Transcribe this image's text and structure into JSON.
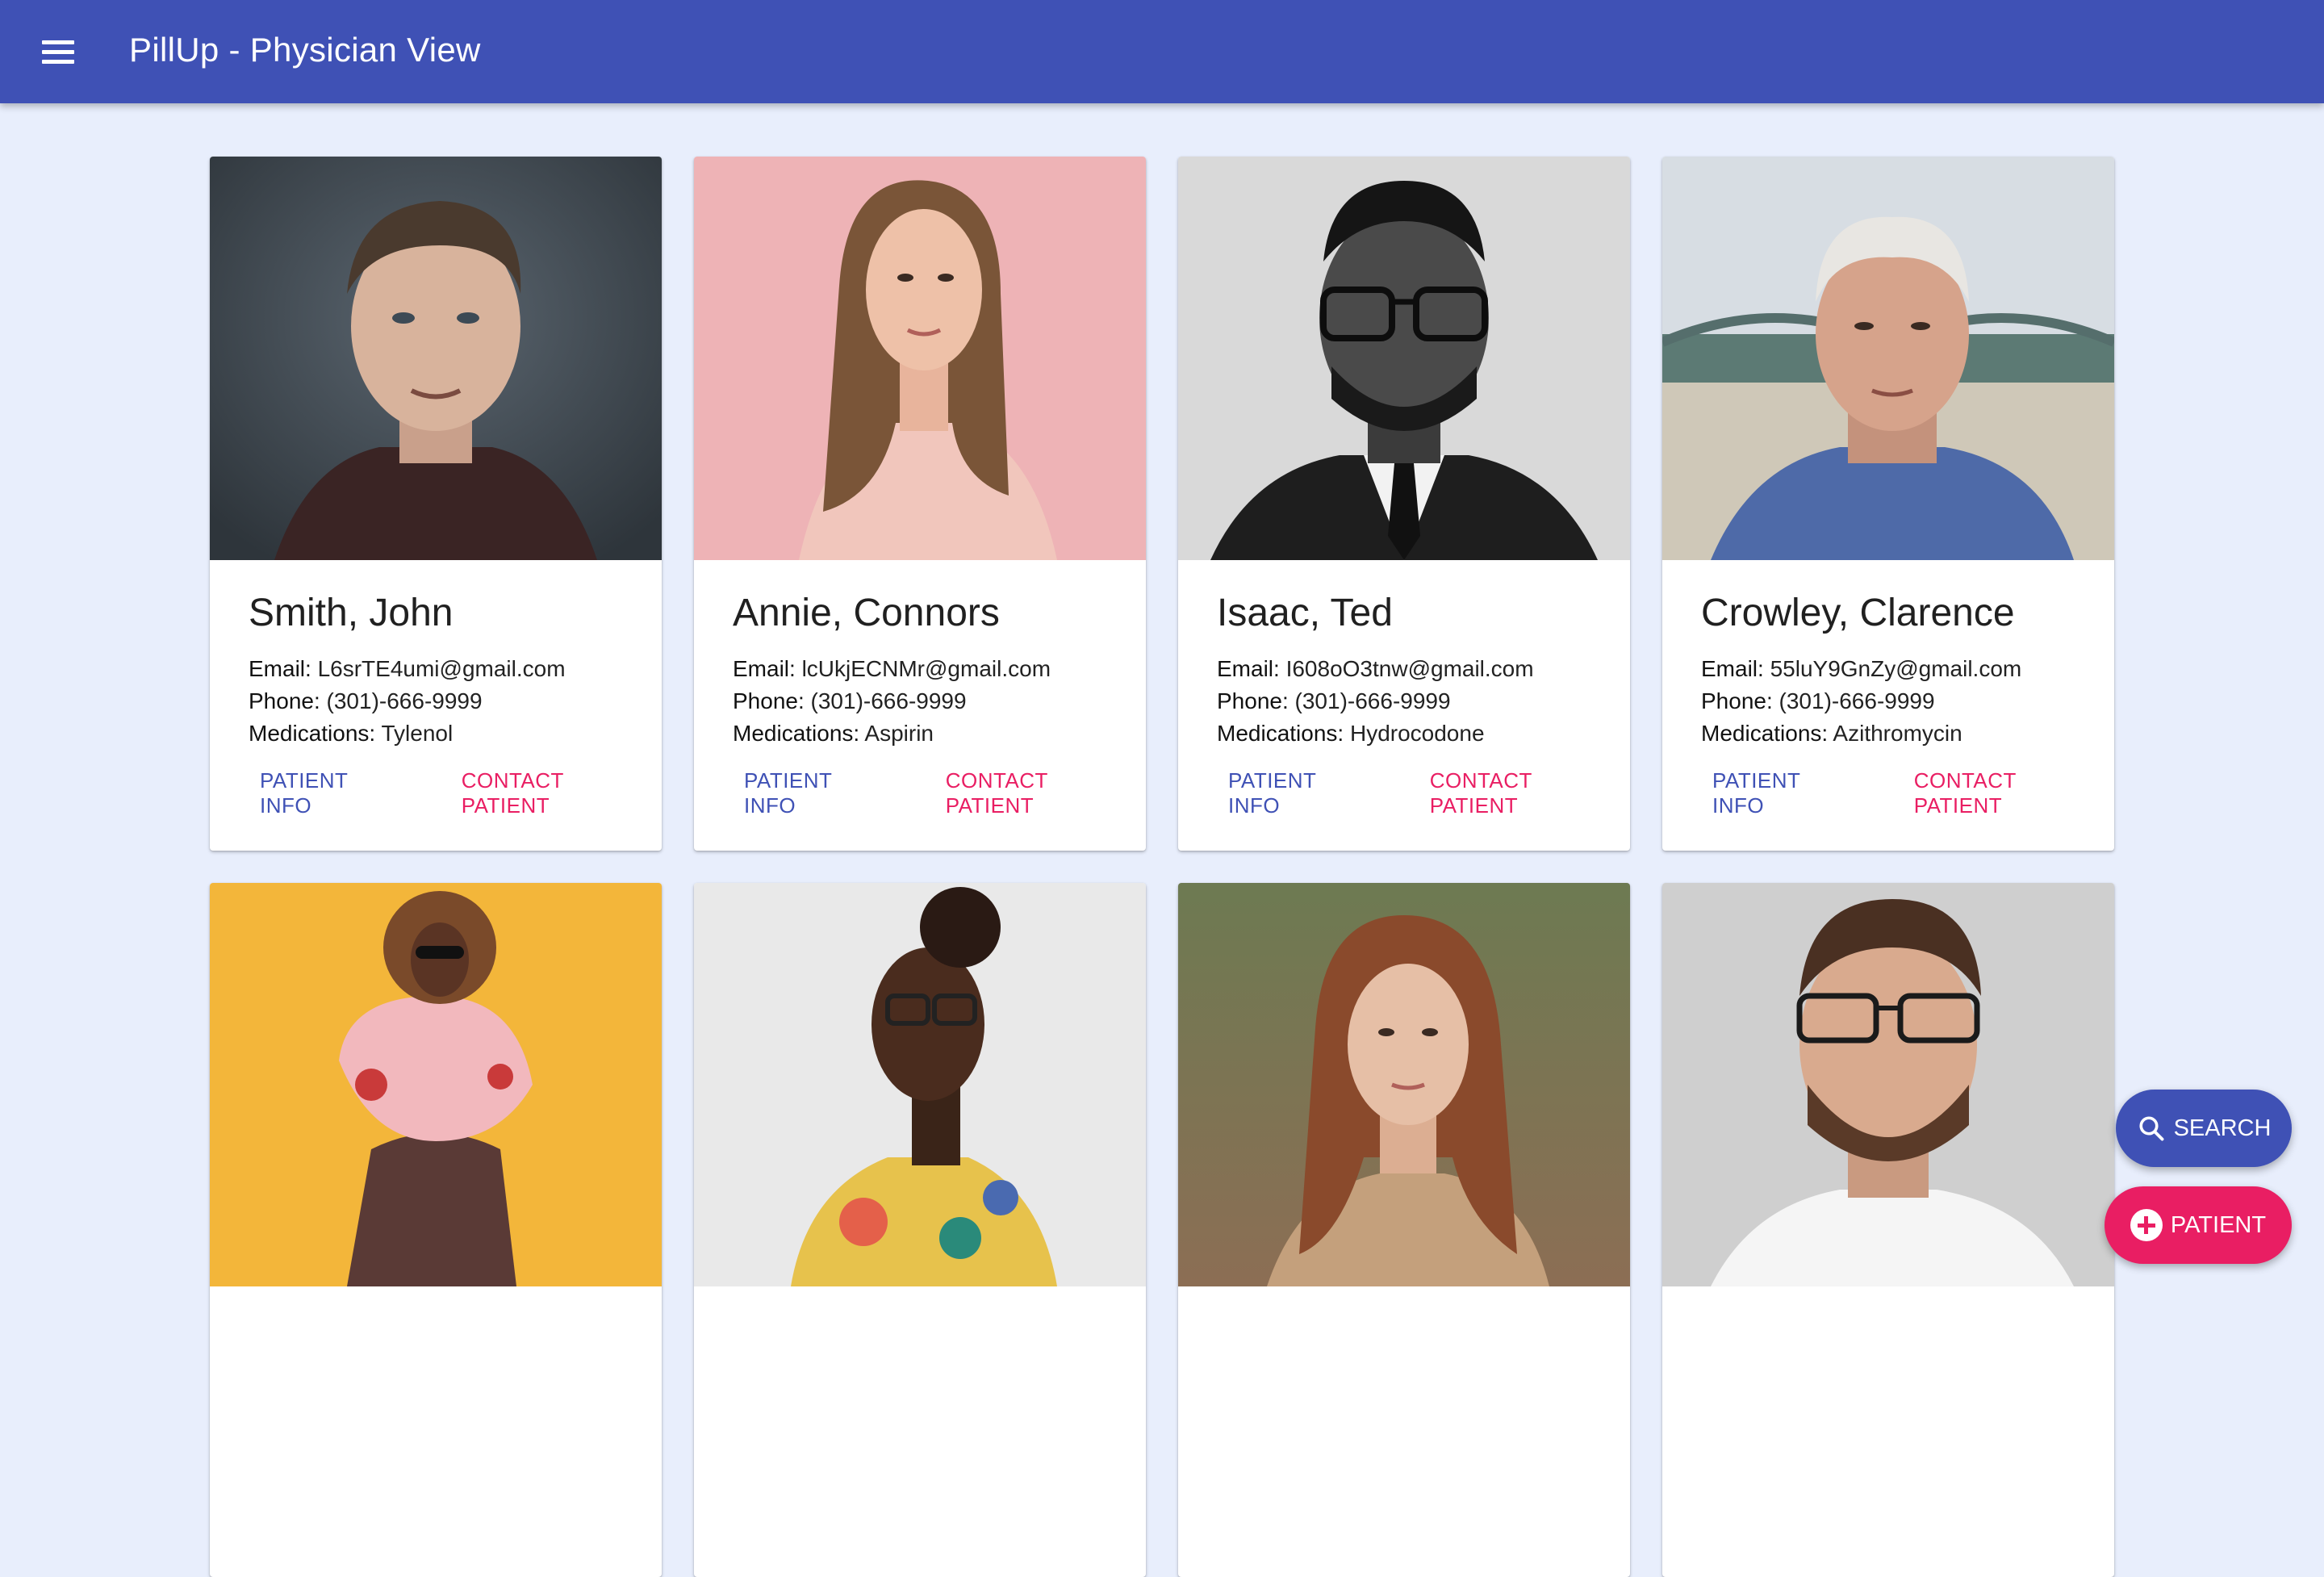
{
  "app": {
    "title": "PillUp - Physician View"
  },
  "labels": {
    "email": "Email:",
    "phone": "Phone:",
    "medications": "Medications:",
    "patient_info": "PATIENT INFO",
    "contact_patient": "CONTACT PATIENT"
  },
  "patients": [
    {
      "name": "Smith, John",
      "email": "L6srTE4umi@gmail.com",
      "phone": "(301)-666-9999",
      "medications": "Tylenol"
    },
    {
      "name": "Annie, Connors",
      "email": "lcUkjECNMr@gmail.com",
      "phone": "(301)-666-9999",
      "medications": "Aspirin"
    },
    {
      "name": "Isaac, Ted",
      "email": "I608oO3tnw@gmail.com",
      "phone": "(301)-666-9999",
      "medications": "Hydrocodone"
    },
    {
      "name": "Crowley, Clarence",
      "email": "55luY9GnZy@gmail.com",
      "phone": "(301)-666-9999",
      "medications": "Azithromycin"
    }
  ],
  "fab": {
    "search": "SEARCH",
    "add_patient": "PATIENT"
  },
  "colors": {
    "primary": "#3f51b5",
    "accent": "#e91e63",
    "background": "#e8eefc"
  }
}
